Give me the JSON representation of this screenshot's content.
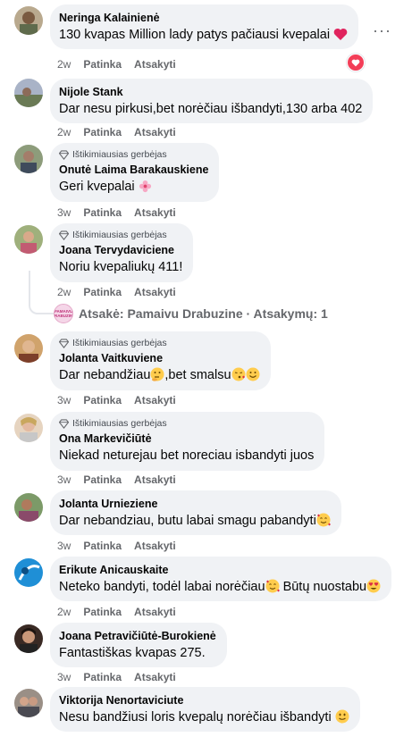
{
  "more_menu": "···",
  "actions": {
    "like": "Patinka",
    "reply": "Atsakyti"
  },
  "badge_label": "Ištikimiausias gerbėjas",
  "comments": [
    {
      "author": "Neringa Kalainienė",
      "text": "130 kvapas Million lady patys pačiausi kvepalai ",
      "time": "2w",
      "emoji": "heart",
      "reaction": "heart-reaction"
    },
    {
      "author": "Nijole Stank",
      "text": "Dar nesu pirkusi,bet norėčiau išbandyti,130 arba 402",
      "time": "2w"
    },
    {
      "author": "Onutė Laima Barakauskiene",
      "text": "Geri kvepalai ",
      "time": "3w",
      "badge": true,
      "emoji": "flower"
    },
    {
      "author": "Joana Tervydaviciene",
      "text": "Noriu kvepaliukų 411!",
      "time": "2w",
      "badge": true
    },
    {
      "author": "Jolanta Vaitkuviene",
      "text_a": "Dar nebandžiau",
      "text_b": ",bet smalsu",
      "time": "3w",
      "badge": true
    },
    {
      "author": "Ona Markevičiūtė",
      "text": "Niekad neturejau bet noreciau isbandyti juos",
      "time": "3w",
      "badge": true
    },
    {
      "author": "Jolanta Urnieziene",
      "text": "Dar nebandziau, butu labai smagu pabandyti",
      "time": "3w"
    },
    {
      "author": "Erikute Anicauskaite",
      "text_a": "Neteko bandyti, todėl labai norėčiau",
      "text_b": " Būtų nuostabu",
      "time": "2w"
    },
    {
      "author": "Joana Petravičiūtė-Burokienė",
      "text": "Fantastiškas kvapas 275.",
      "time": "3w"
    },
    {
      "author": "Viktorija Nenortaviciute",
      "text": "Nesu bandžiusi loris kvepalų norėčiau išbandyti ",
      "time": "3w"
    }
  ],
  "reply_summary": {
    "text": "Atsakė: Pamaivu Drabuzine · Atsakymų: 1",
    "avatar_text": "PAMAIVU DRABUZINE"
  },
  "colors": {
    "bubble": "#f0f2f5",
    "meta": "#65676b",
    "heart": "#f33e58"
  }
}
